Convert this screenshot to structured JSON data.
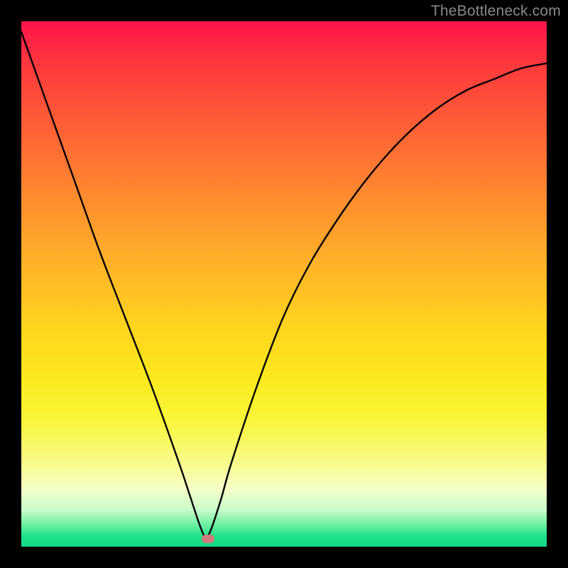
{
  "watermark": {
    "text": "TheBottleneck.com"
  },
  "chart_data": {
    "type": "line",
    "title": "",
    "xlabel": "",
    "ylabel": "",
    "xlim": [
      0,
      100
    ],
    "ylim": [
      0,
      100
    ],
    "grid": false,
    "x": [
      0,
      5,
      10,
      15,
      20,
      25,
      30,
      32,
      34,
      35,
      36,
      38,
      40,
      45,
      50,
      55,
      60,
      65,
      70,
      75,
      80,
      85,
      90,
      95,
      100
    ],
    "y": [
      98,
      84,
      70,
      56,
      43,
      30,
      16,
      10,
      4,
      2,
      3,
      9,
      16,
      31,
      44,
      54,
      62,
      69,
      75,
      80,
      84,
      87,
      89,
      91,
      92
    ],
    "marker": {
      "x": 35.5,
      "y": 1.5
    },
    "background": {
      "top_color": "#ff144a",
      "mid_color": "#fff53a",
      "bottom_color": "#12d884"
    }
  }
}
